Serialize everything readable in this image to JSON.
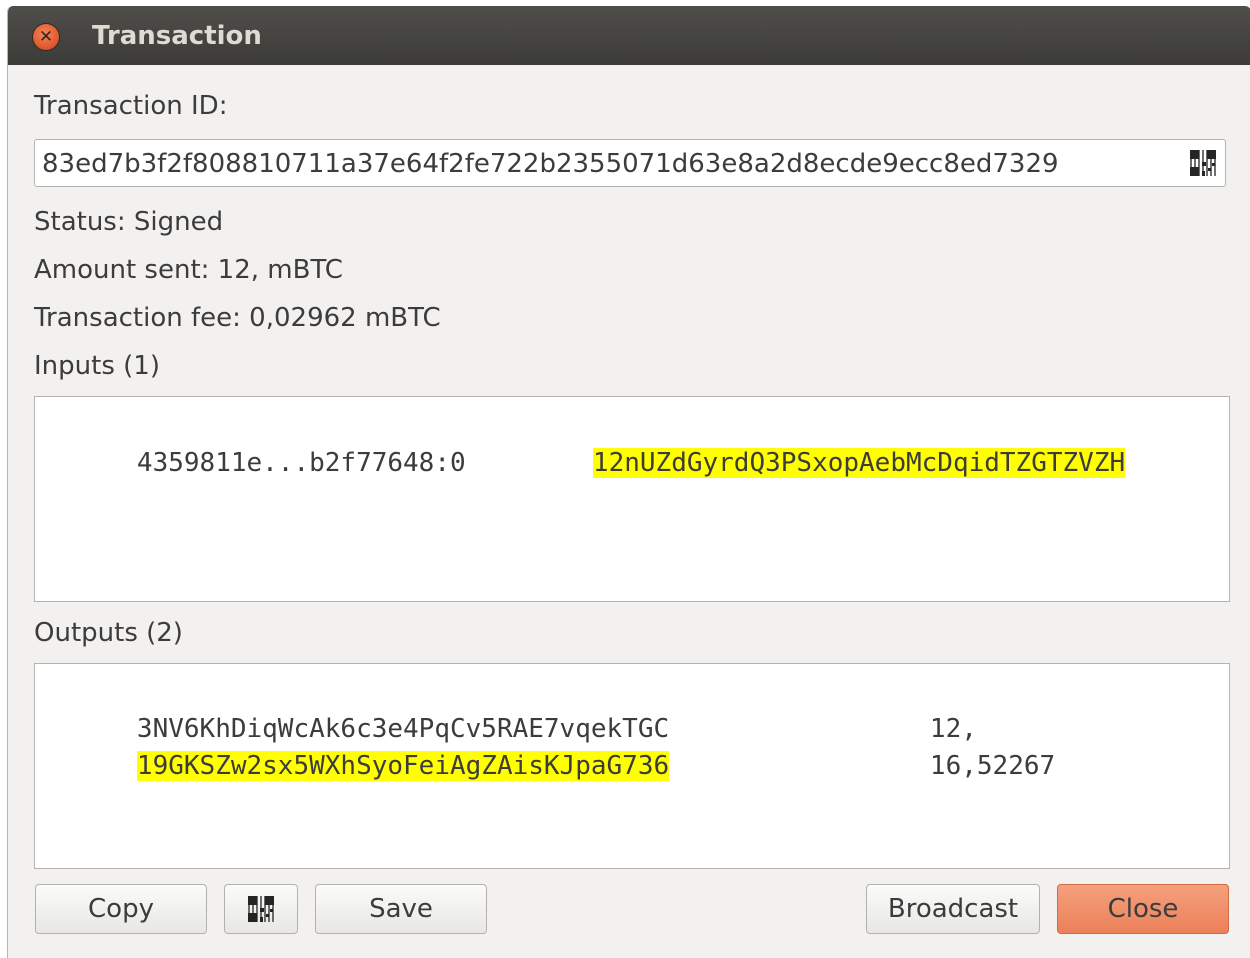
{
  "window": {
    "title": "Transaction"
  },
  "txid": {
    "label": "Transaction ID:",
    "value": "83ed7b3f2f808810711a37e64f2fe722b2355071d63e8a2d8ecde9ecc8ed7329"
  },
  "info": {
    "status": "Status: Signed",
    "amount": "Amount sent: 12, mBTC",
    "fee": "Transaction fee: 0,02962 mBTC"
  },
  "inputs": {
    "label": "Inputs (1)",
    "rows": [
      {
        "prevout": "4359811e...b2f77648:0",
        "address": "12nUZdGyrdQ3PSxopAebMcDqidTZGTZVZH",
        "highlighted": true
      }
    ]
  },
  "outputs": {
    "label": "Outputs (2)",
    "rows": [
      {
        "address": "3NV6KhDiqWcAk6c3e4PqCv5RAE7vqekTGC",
        "amount": "12,",
        "highlighted": false
      },
      {
        "address": "19GKSZw2sx5WXhSyoFeiAgZAisKJpaG736",
        "amount": "16,52267",
        "highlighted": true
      }
    ]
  },
  "buttons": {
    "copy": "Copy",
    "save": "Save",
    "broadcast": "Broadcast",
    "close": "Close"
  },
  "icons": {
    "window_close": "close-icon",
    "qr": "qr-code-icon"
  },
  "colors": {
    "highlight": "#ffff00",
    "close_button": "#ec8059",
    "titlebar": "#3c3b37"
  }
}
